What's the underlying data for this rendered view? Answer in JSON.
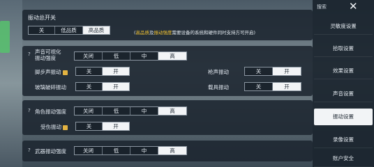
{
  "master": {
    "title": "振动总开关",
    "options": [
      "关",
      "低品质",
      "高品质"
    ],
    "selected": 2,
    "hint_pre": "(",
    "hint_hq": "高品质",
    "hint_mid": "及",
    "hint_strength": "振动强度",
    "hint_post": "需要设备的系统和硬件同时支持方可开启)"
  },
  "sound": {
    "visual_label_1": "声音可视化",
    "visual_label_2": "振动强度",
    "visual_options": [
      "关闭",
      "低",
      "中",
      "高"
    ],
    "visual_selected": 3,
    "footstep_label": "脚步声振动",
    "footstep_options": [
      "关",
      "开"
    ],
    "footstep_selected": 1,
    "gunfire_label": "枪声振动",
    "gunfire_options": [
      "关",
      "开"
    ],
    "gunfire_selected": 1,
    "glass_label": "玻璃破碎振动",
    "glass_options": [
      "关",
      "开"
    ],
    "glass_selected": 1,
    "vehicle_label": "载具振动",
    "vehicle_options": [
      "关",
      "开"
    ],
    "vehicle_selected": 1
  },
  "character": {
    "strength_label": "角色振动强度",
    "strength_options": [
      "关闭",
      "低",
      "中",
      "高"
    ],
    "strength_selected": 3,
    "hit_label": "受伤振动",
    "hit_options": [
      "关",
      "开"
    ],
    "hit_selected": 1
  },
  "weapon": {
    "strength_label": "武器振动强度",
    "strength_options": [
      "关闭",
      "低",
      "中",
      "高"
    ],
    "strength_selected": 3
  },
  "sidebar": {
    "search": "搜索",
    "items": [
      "灵敏度设置",
      "拾取设置",
      "效果设置",
      "声音设置",
      "振动设置",
      "录像设置",
      "账户安全"
    ],
    "active": 4
  }
}
